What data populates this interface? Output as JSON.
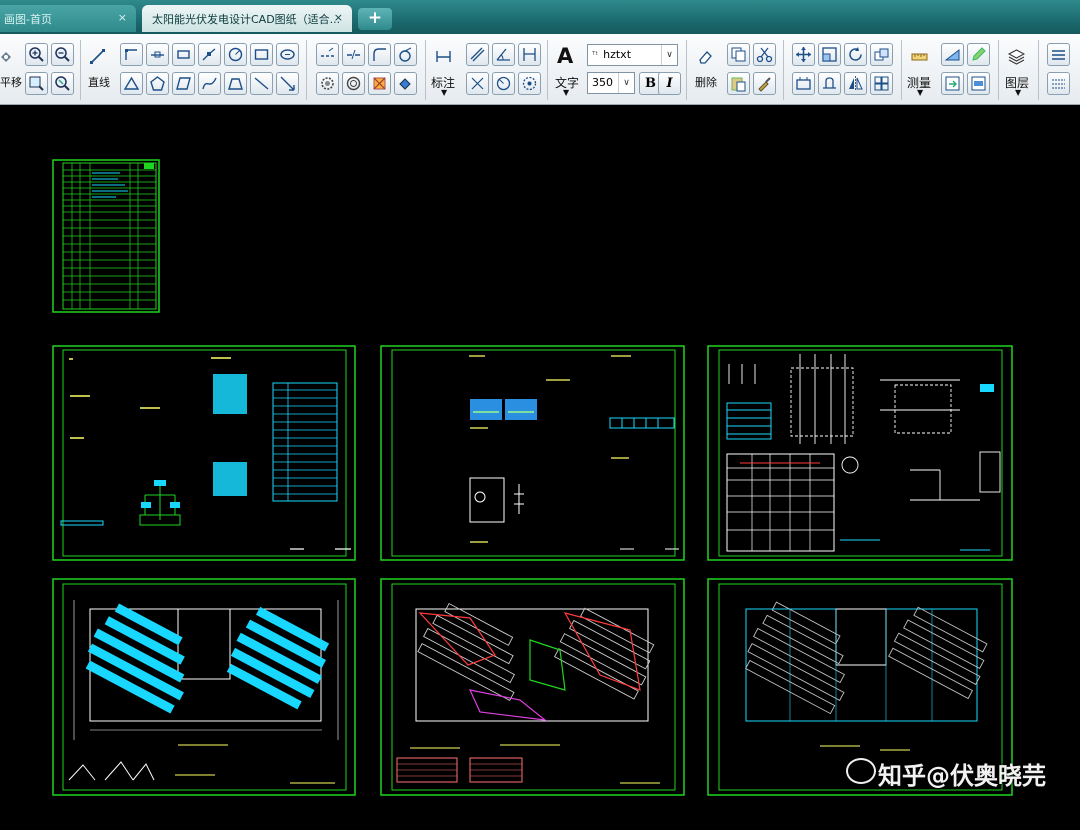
{
  "tabs": [
    {
      "label": "画图-首页",
      "close": "×"
    },
    {
      "label": "太阳能光伏发电设计CAD图纸（适合...",
      "close": "×"
    }
  ],
  "new_tab": "+",
  "toolbar": {
    "pan_label": "平移",
    "line_label": "直线",
    "dimension_label": "标注",
    "text_label": "文字",
    "font_value": "hztxt",
    "size_value": "350",
    "bold_label": "B",
    "italic_label": "I",
    "delete_label": "删除",
    "measure_label": "测量",
    "layer_label": "图层"
  },
  "colors": {
    "frame": "#1fd61f",
    "cyan": "#19d8ff",
    "red": "#ff3b3b",
    "background": "#000000"
  },
  "watermark": "知乎@伏奥晓芫"
}
